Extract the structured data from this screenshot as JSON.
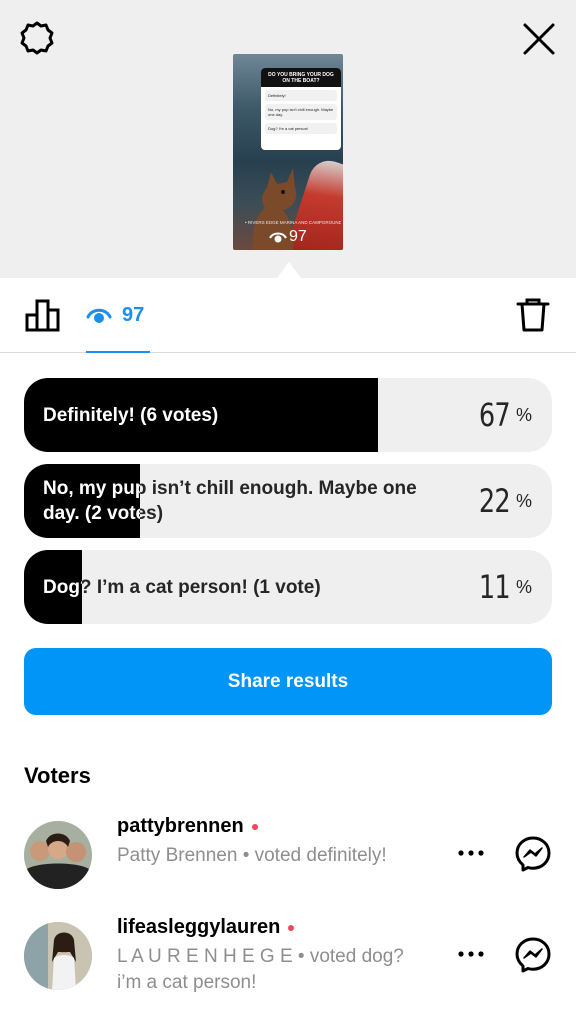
{
  "story": {
    "question": "DO YOU BRING YOUR DOG ON THE BOAT?",
    "options": [
      "Definitely!",
      "No, my pup isn't chill enough. Maybe one day.",
      "Dog? I'm a cat person!"
    ],
    "location": "• RIVERS EDGE MARINA AND CAMPGROUND",
    "views": "97"
  },
  "tabs": {
    "viewers_count": "97"
  },
  "poll_results": [
    {
      "label": "Definitely! (6 votes)",
      "percent_value": "67",
      "percent_sign": "%",
      "fill_fraction": 0.67
    },
    {
      "label": "No, my pup isn’t chill enough. Maybe one day. (2 votes)",
      "percent_value": "22",
      "percent_sign": "%",
      "fill_fraction": 0.22
    },
    {
      "label": "Dog? I’m a cat person! (1 vote)",
      "percent_value": "11",
      "percent_sign": "%",
      "fill_fraction": 0.11
    }
  ],
  "share_label": "Share results",
  "voters_title": "Voters",
  "voters": [
    {
      "username": "pattybrennen",
      "subtitle": "Patty Brennen • voted definitely!"
    },
    {
      "username": "lifeasleggylauren",
      "subtitle": "L A U R E N H E G E • voted dog? i’m a cat person!"
    }
  ],
  "colors": {
    "accent": "#0095f6",
    "tab_blue": "#1a8ff0",
    "unread_dot": "#ed4956",
    "bar_fill": "#000000",
    "bar_bg": "#efefef"
  },
  "icons": [
    "gear-icon",
    "close-icon",
    "bar-chart-icon",
    "eye-icon",
    "trash-icon",
    "more-icon",
    "messenger-icon"
  ]
}
